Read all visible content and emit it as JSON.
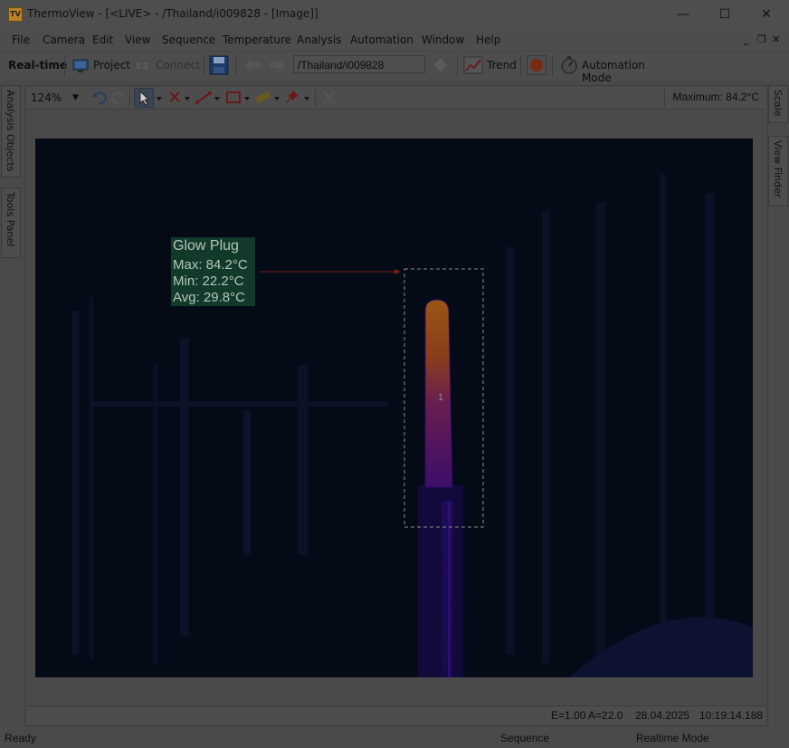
{
  "window": {
    "app_icon_text": "TV",
    "title": "ThermoView - [<LIVE> - /Thailand/i009828 - [Image]]",
    "minimize": "—",
    "maximize": "☐",
    "close": "✕"
  },
  "menu": {
    "items": [
      "File",
      "Camera",
      "Edit",
      "View",
      "Sequence",
      "Temperature",
      "Analysis",
      "Automation",
      "Window",
      "Help"
    ],
    "mdi_minimize": "_",
    "mdi_restore": "❐",
    "mdi_close": "✕"
  },
  "toolbar": {
    "realtime_label": "Real-time",
    "project_label": "Project",
    "connect_label": "Connect",
    "path_value": "/Thailand/i009828",
    "trend_label": "Trend",
    "automation_label": "Automation Mode"
  },
  "side_tabs": {
    "left": [
      "Analysis Objects",
      "Tools Panel"
    ],
    "right": [
      "Scale",
      "View Finder"
    ]
  },
  "image_toolbar": {
    "zoom": "124%",
    "maximum_label": "Maximum: 84.2°C"
  },
  "measurement": {
    "name": "Glow Plug",
    "max": "Max: 84.2°C",
    "min": "Min:  22.2°C",
    "avg": "Avg:  29.8°C",
    "roi_number": "1",
    "label_color": "#123a2b",
    "arrow_color": "#8b1a1a"
  },
  "info_bar": {
    "emissivity": "E=1.00 A=22.0",
    "date": "28.04.2025",
    "time": "10:19:14.188"
  },
  "status": {
    "ready": "Ready",
    "sequence": "Sequence",
    "mode": "Realtime Mode"
  }
}
